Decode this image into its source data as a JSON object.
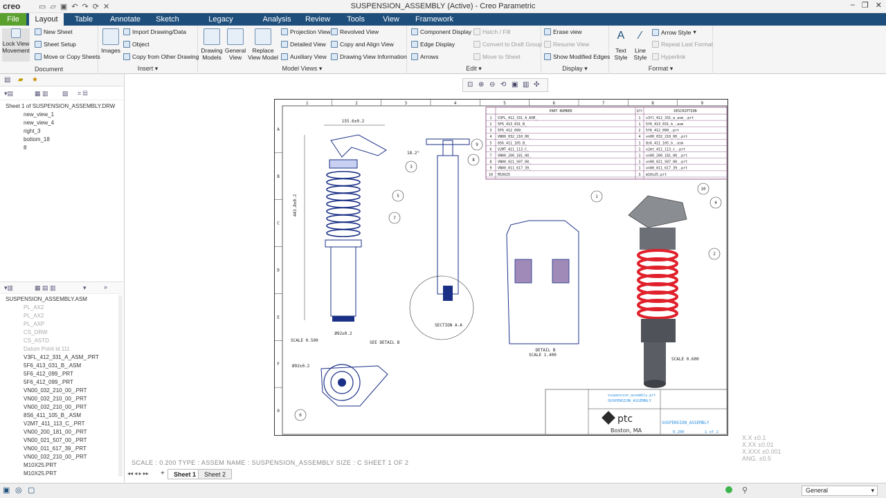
{
  "app": {
    "logo": "creo",
    "title": "SUSPENSION_ASSEMBLY (Active) - Creo Parametric"
  },
  "tabs": [
    "File",
    "Layout",
    "Table",
    "Annotate",
    "Sketch",
    "Legacy Migration",
    "Analysis",
    "Review",
    "Tools",
    "View",
    "Framework"
  ],
  "ribbon": {
    "document": {
      "label": "Document",
      "lock": "Lock View Movement",
      "items": [
        "New Sheet",
        "Sheet Setup",
        "Move or Copy Sheets"
      ]
    },
    "insert": {
      "label": "Insert",
      "images": "Images",
      "items": [
        "Import Drawing/Data",
        "Object",
        "Copy from Other Drawing"
      ]
    },
    "model_views": {
      "label": "Model Views",
      "big": [
        "Drawing Models",
        "General View",
        "Replace View Model"
      ],
      "items": [
        "Projection View",
        "Detailed View",
        "Auxiliary View",
        "Revolved View",
        "Copy and Align View",
        "Drawing View Information"
      ]
    },
    "edit": {
      "label": "Edit",
      "items": [
        "Component Display",
        "Edge Display",
        "Arrows",
        "Hatch / Fill",
        "Convert to Draft Group",
        "Move to Sheet"
      ]
    },
    "display": {
      "label": "Display",
      "items": [
        "Erase view",
        "Resume View",
        "Show Modified Edges"
      ]
    },
    "format": {
      "label": "Format",
      "big": [
        "Text Style",
        "Line Style"
      ],
      "items": [
        "Arrow Style",
        "Repeat Last Format",
        "Hyperlink"
      ]
    }
  },
  "drawing_tree": [
    "Sheet 1 of SUSPENSION_ASSEMBLY.DRW",
    "new_view_1",
    "new_view_4",
    "right_3",
    "bottom_18",
    "8"
  ],
  "model_tree": {
    "root": "SUSPENSION_ASSEMBLY.ASM",
    "features": [
      "PL_AX2",
      "PL_AX2",
      "PL_AXP",
      "CS_DRW",
      "CS_ASTD",
      "Datum Point id 111"
    ],
    "parts": [
      "V3FL_412_331_A_ASM_.PRT",
      "5F6_413_031_B_.ASM",
      "5F6_412_099_.PRT",
      "5F6_412_099_.PRT",
      "VN00_032_210_00_.PRT",
      "VN00_032_210_00_.PRT",
      "VN00_032_210_00_.PRT",
      "8S6_411_105_B_.ASM",
      "V2MT_411_113_C_.PRT",
      "VN00_200_181_00_.PRT",
      "VN00_021_507_00_.PRT",
      "VN00_011_617_39_.PRT",
      "VN00_032_210_00_.PRT",
      "M10X25.PRT",
      "M10X25.PRT"
    ]
  },
  "status": "SCALE : 0.200    TYPE : ASSEM    NAME : SUSPENSION_ASSEMBLY    SIZE : C    SHEET 1  OF 2",
  "sheets": [
    "Sheet 1",
    "Sheet 2"
  ],
  "filter": "General",
  "tolerances": [
    "X.X   ±0.1",
    "X.XX  ±0.01",
    "X.XXX ±0.001",
    "ANG.  ±0.5"
  ],
  "drawing": {
    "cols": [
      "1",
      "2",
      "3",
      "4",
      "5",
      "6",
      "7",
      "8",
      "9"
    ],
    "rows": [
      "A",
      "B",
      "C",
      "D",
      "E",
      "F",
      "0"
    ],
    "bom_headers": [
      "PART NUMBER",
      "QTY",
      "DESCRIPTION"
    ],
    "bom": [
      [
        "1",
        "V3FL_412_331_A_ASM_",
        "1",
        "v3fl_412_331_a_asm_.prt"
      ],
      [
        "2",
        "5F6_413_031_B_",
        "1",
        "5f6_413_031_b_.asm"
      ],
      [
        "3",
        "5F6_412_099_",
        "2",
        "5f6_412_099_.prt"
      ],
      [
        "4",
        "VN00_032_210_00_",
        "4",
        "vn00_032_210_00_.prt"
      ],
      [
        "5",
        "8S6_411_105_B_",
        "1",
        "8s6_411_105_b_.asm"
      ],
      [
        "6",
        "V2MT_411_113_C_",
        "1",
        "v2mt_411_113_c_.prt"
      ],
      [
        "7",
        "VN00_200_181_00_",
        "1",
        "vn00_200_181_00_.prt"
      ],
      [
        "8",
        "VN00_021_507_00_",
        "1",
        "vn00_021_507_00_.prt"
      ],
      [
        "9",
        "VN00_011_617_39_",
        "1",
        "vn00_011_617_39_.prt"
      ],
      [
        "10",
        "M10X25",
        "3",
        "m10x25.prt"
      ]
    ],
    "dims": {
      "width": "155.6±0.2",
      "height": "443.8±0.2",
      "bottom": "Ø92±0.2",
      "angle": "18.2°",
      "top": "Ø92±0.2"
    },
    "labels": {
      "scale1": "SCALE 0.500",
      "section": "SECTION A-A",
      "see_detail": "SEE DETAIL B",
      "detail": "DETAIL B",
      "detail_scale": "SCALE 1.400",
      "scale3": "SCALE 0.600"
    },
    "title_block": {
      "company": "ptc",
      "city": "Boston, MA",
      "part": "suspension_assembly.prt",
      "name": "SUSPENSION_ASSEMBLY",
      "scale": "0.200",
      "sheet": "1 of 2"
    }
  }
}
